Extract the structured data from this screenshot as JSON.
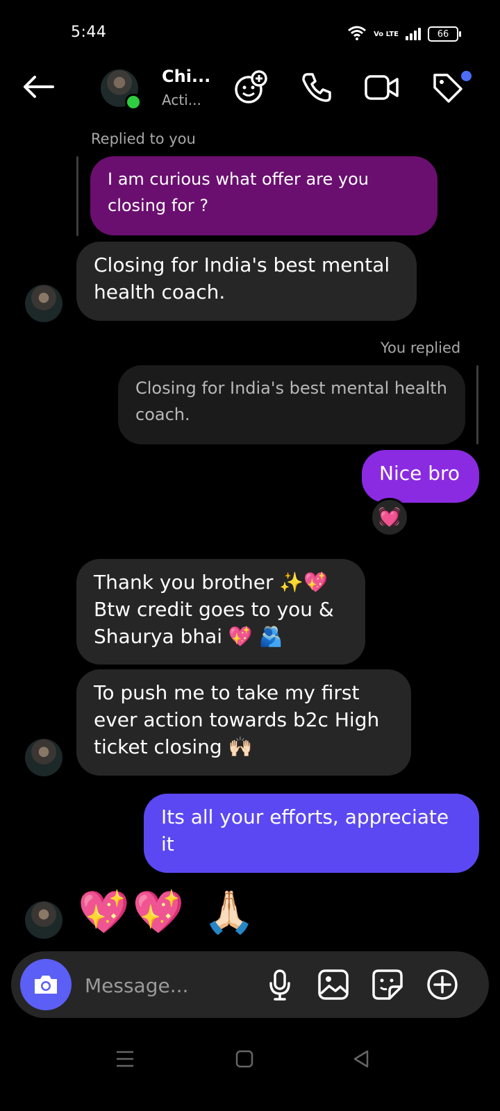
{
  "status_bar": {
    "time": "5:44",
    "network": "Vo LTE",
    "battery": "66"
  },
  "header": {
    "name": "Chi...",
    "status": "Acti..."
  },
  "messages": {
    "replied_label_1": "Replied to you",
    "quoted_1": "I am curious what offer are you closing for ?",
    "incoming_1": "Closing for India's best mental health coach.",
    "replied_label_2": "You replied",
    "quoted_2": "Closing for India's best mental health coach.",
    "outgoing_1": "Nice bro",
    "reaction_1": "💓",
    "incoming_2": "Thank you brother ✨💖 Btw credit goes to you & Shaurya bhai 💖 🫂",
    "incoming_3": "To push me to take my first ever action towards b2c High ticket closing 🙌🏻",
    "outgoing_2": "Its all your efforts, appreciate it",
    "incoming_4": "💖💖 🙏🏻"
  },
  "composer": {
    "placeholder": "Message..."
  },
  "colors": {
    "background": "#000000",
    "incoming_bubble": "#262626",
    "quoted_purple": "#6a0f6f",
    "outgoing_purple": "#8a2be2",
    "outgoing_indigo": "#5b48f2",
    "camera_button": "#5b5ff5",
    "online_dot": "#2ecc40"
  }
}
